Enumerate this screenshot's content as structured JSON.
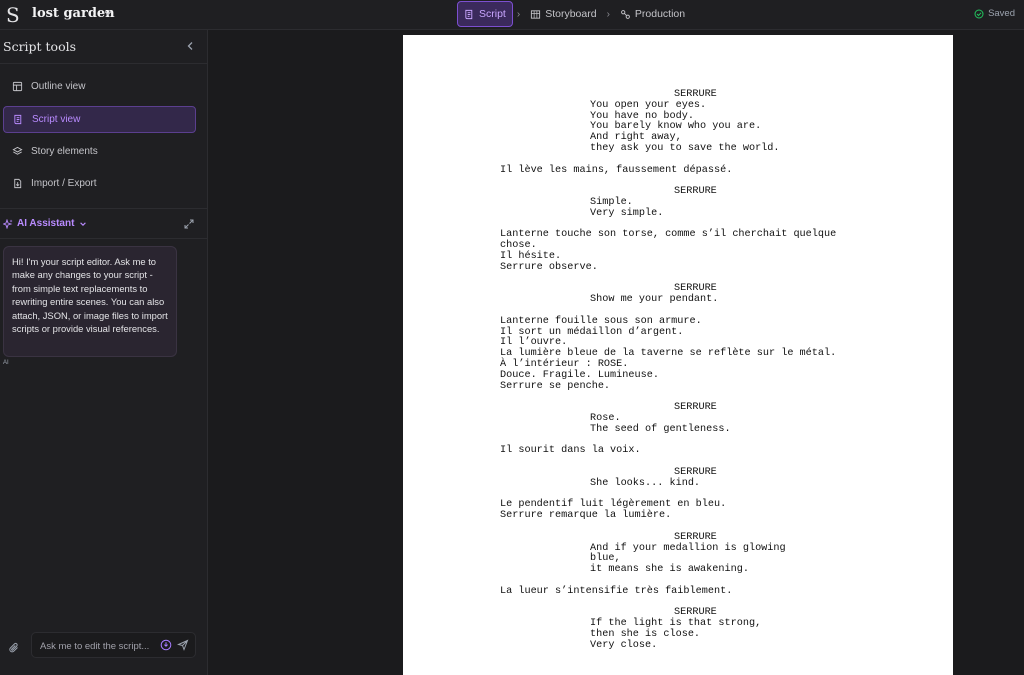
{
  "app": {
    "project_name": "lost garden",
    "logo_letter": "S"
  },
  "nav": {
    "items": [
      {
        "label": "Script",
        "icon": "script-icon",
        "active": true
      },
      {
        "label": "Storyboard",
        "icon": "storyboard-icon",
        "active": false
      },
      {
        "label": "Production",
        "icon": "production-icon",
        "active": false
      }
    ],
    "status": "Saved"
  },
  "sidebar": {
    "title": "Script tools",
    "items": [
      {
        "label": "Outline view",
        "icon": "outline-icon"
      },
      {
        "label": "Script view",
        "icon": "script-view-icon",
        "active": true
      },
      {
        "label": "Story elements",
        "icon": "story-elements-icon"
      },
      {
        "label": "Import / Export",
        "icon": "import-export-icon"
      }
    ],
    "assistant": {
      "title": "AI Assistant",
      "message": "Hi! I'm your script editor. Ask me to make any changes to your script - from simple text replacements to rewriting entire scenes. You can also attach, JSON, or image files to import scripts or provide visual references.",
      "message_sender": "AI",
      "input_placeholder": "Ask me to edit the script..."
    }
  },
  "colors": {
    "accent": "#9b6bff",
    "accent_bg": "#3b2a5c",
    "background": "#1b1b1d",
    "panel": "#1f1f22",
    "saved_green": "#22c55e"
  },
  "script": {
    "lines": [
      {
        "type": "character",
        "text": "SERRURE"
      },
      {
        "type": "dialogue",
        "text": "You open your eyes."
      },
      {
        "type": "dialogue",
        "text": "You have no body."
      },
      {
        "type": "dialogue",
        "text": "You barely know who you are."
      },
      {
        "type": "dialogue",
        "text": "And right away,"
      },
      {
        "type": "dialogue",
        "text": "they ask you to save the world."
      },
      {
        "type": "action",
        "text": "Il lève les mains, faussement dépassé."
      },
      {
        "type": "character",
        "text": "SERRURE"
      },
      {
        "type": "dialogue",
        "text": "Simple."
      },
      {
        "type": "dialogue",
        "text": "Very simple."
      },
      {
        "type": "action",
        "text": "Lanterne touche son torse, comme s’il cherchait quelque"
      },
      {
        "type": "action",
        "text": "chose."
      },
      {
        "type": "action",
        "text": "Il hésite."
      },
      {
        "type": "action",
        "text": "Serrure observe."
      },
      {
        "type": "character",
        "text": "SERRURE"
      },
      {
        "type": "dialogue",
        "text": "Show me your pendant."
      },
      {
        "type": "action",
        "text": "Lanterne fouille sous son armure."
      },
      {
        "type": "action",
        "text": "Il sort un médaillon d’argent."
      },
      {
        "type": "action",
        "text": "Il l’ouvre."
      },
      {
        "type": "action",
        "text": "La lumière bleue de la taverne se reflète sur le métal."
      },
      {
        "type": "action",
        "text": "À l’intérieur : ROSE."
      },
      {
        "type": "action",
        "text": "Douce. Fragile. Lumineuse."
      },
      {
        "type": "action",
        "text": "Serrure se penche."
      },
      {
        "type": "character",
        "text": "SERRURE"
      },
      {
        "type": "dialogue",
        "text": "Rose."
      },
      {
        "type": "dialogue",
        "text": "The seed of gentleness."
      },
      {
        "type": "action",
        "text": "Il sourit dans la voix."
      },
      {
        "type": "character",
        "text": "SERRURE"
      },
      {
        "type": "dialogue",
        "text": "She looks... kind."
      },
      {
        "type": "action",
        "text": "Le pendentif luit légèrement en bleu."
      },
      {
        "type": "action",
        "text": "Serrure remarque la lumière."
      },
      {
        "type": "character",
        "text": "SERRURE"
      },
      {
        "type": "dialogue",
        "text": "And if your medallion is glowing"
      },
      {
        "type": "dialogue",
        "text": "blue,"
      },
      {
        "type": "dialogue",
        "text": "it means she is awakening."
      },
      {
        "type": "action",
        "text": "La lueur s’intensifie très faiblement."
      },
      {
        "type": "character",
        "text": "SERRURE"
      },
      {
        "type": "dialogue",
        "text": "If the light is that strong,"
      },
      {
        "type": "dialogue",
        "text": "then she is close."
      },
      {
        "type": "dialogue",
        "text": "Very close."
      }
    ]
  }
}
